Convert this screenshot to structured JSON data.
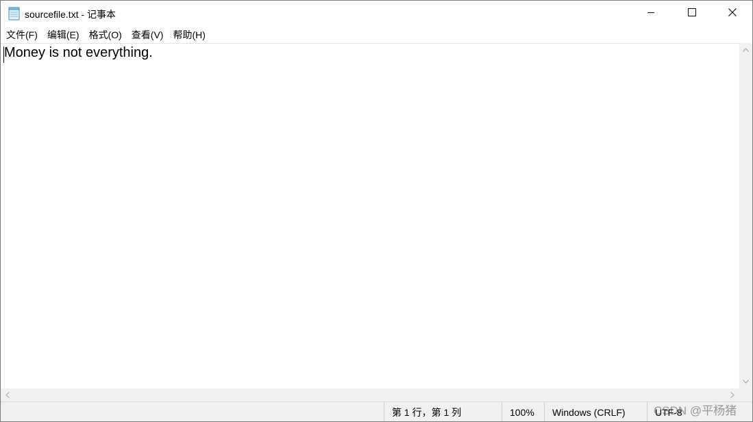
{
  "window": {
    "title": "sourcefile.txt - 记事本"
  },
  "icons": {
    "app": "notepad-icon",
    "minimize": "minimize-icon",
    "maximize": "maximize-icon",
    "close": "close-icon"
  },
  "menu": [
    {
      "label": "文件(F)"
    },
    {
      "label": "编辑(E)"
    },
    {
      "label": "格式(O)"
    },
    {
      "label": "查看(V)"
    },
    {
      "label": "帮助(H)"
    }
  ],
  "editor": {
    "content": "Money is not everything."
  },
  "status": {
    "position": "第 1 行，第 1 列",
    "zoom": "100%",
    "line_ending": "Windows (CRLF)",
    "encoding": "UTF-8"
  },
  "watermark": "CSDN @平杨猪"
}
